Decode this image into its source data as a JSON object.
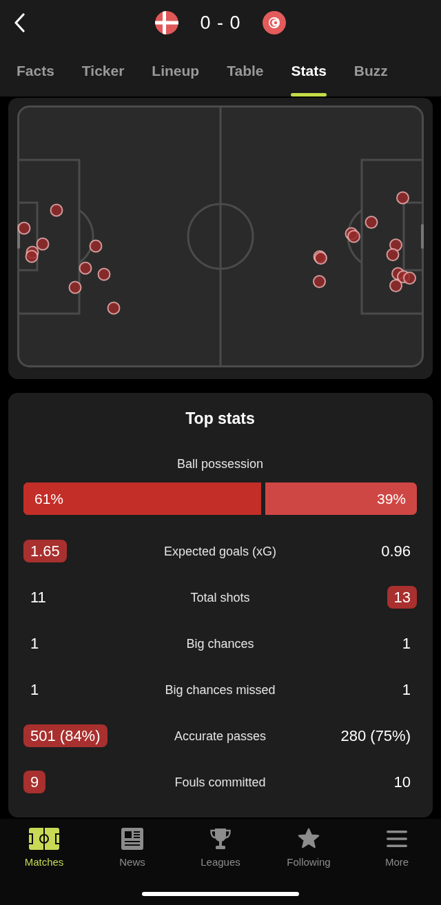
{
  "header": {
    "score": "0 - 0"
  },
  "tabs": [
    {
      "label": "Facts",
      "selected": false
    },
    {
      "label": "Ticker",
      "selected": false
    },
    {
      "label": "Lineup",
      "selected": false
    },
    {
      "label": "Table",
      "selected": false
    },
    {
      "label": "Stats",
      "selected": true
    },
    {
      "label": "Buzz",
      "selected": false
    }
  ],
  "top_stats": {
    "title": "Top stats",
    "possession": {
      "label": "Ball possession",
      "home": "61%",
      "away": "39%",
      "level": 0.61
    },
    "rows": [
      {
        "label": "Expected goals (xG)",
        "home": {
          "value": "1.65",
          "highlighted": true
        },
        "away": {
          "value": "0.96",
          "highlighted": false
        }
      },
      {
        "label": "Total shots",
        "home": {
          "value": "11",
          "highlighted": false
        },
        "away": {
          "value": "13",
          "highlighted": true
        }
      },
      {
        "label": "Big chances",
        "home": {
          "value": "1",
          "highlighted": false
        },
        "away": {
          "value": "1",
          "highlighted": false
        }
      },
      {
        "label": "Big chances missed",
        "home": {
          "value": "1",
          "highlighted": false
        },
        "away": {
          "value": "1",
          "highlighted": false
        }
      },
      {
        "label": "Accurate passes",
        "home": {
          "value": "501 (84%)",
          "highlighted": true
        },
        "away": {
          "value": "280 (75%)",
          "highlighted": false
        }
      },
      {
        "label": "Fouls committed",
        "home": {
          "value": "9",
          "highlighted": true
        },
        "away": {
          "value": "10",
          "highlighted": false
        }
      }
    ]
  },
  "bottom_nav": [
    {
      "label": "Matches",
      "selected": true
    },
    {
      "label": "News",
      "selected": false
    },
    {
      "label": "Leagues",
      "selected": false
    },
    {
      "label": "Following",
      "selected": false
    },
    {
      "label": "More",
      "selected": false
    }
  ]
}
